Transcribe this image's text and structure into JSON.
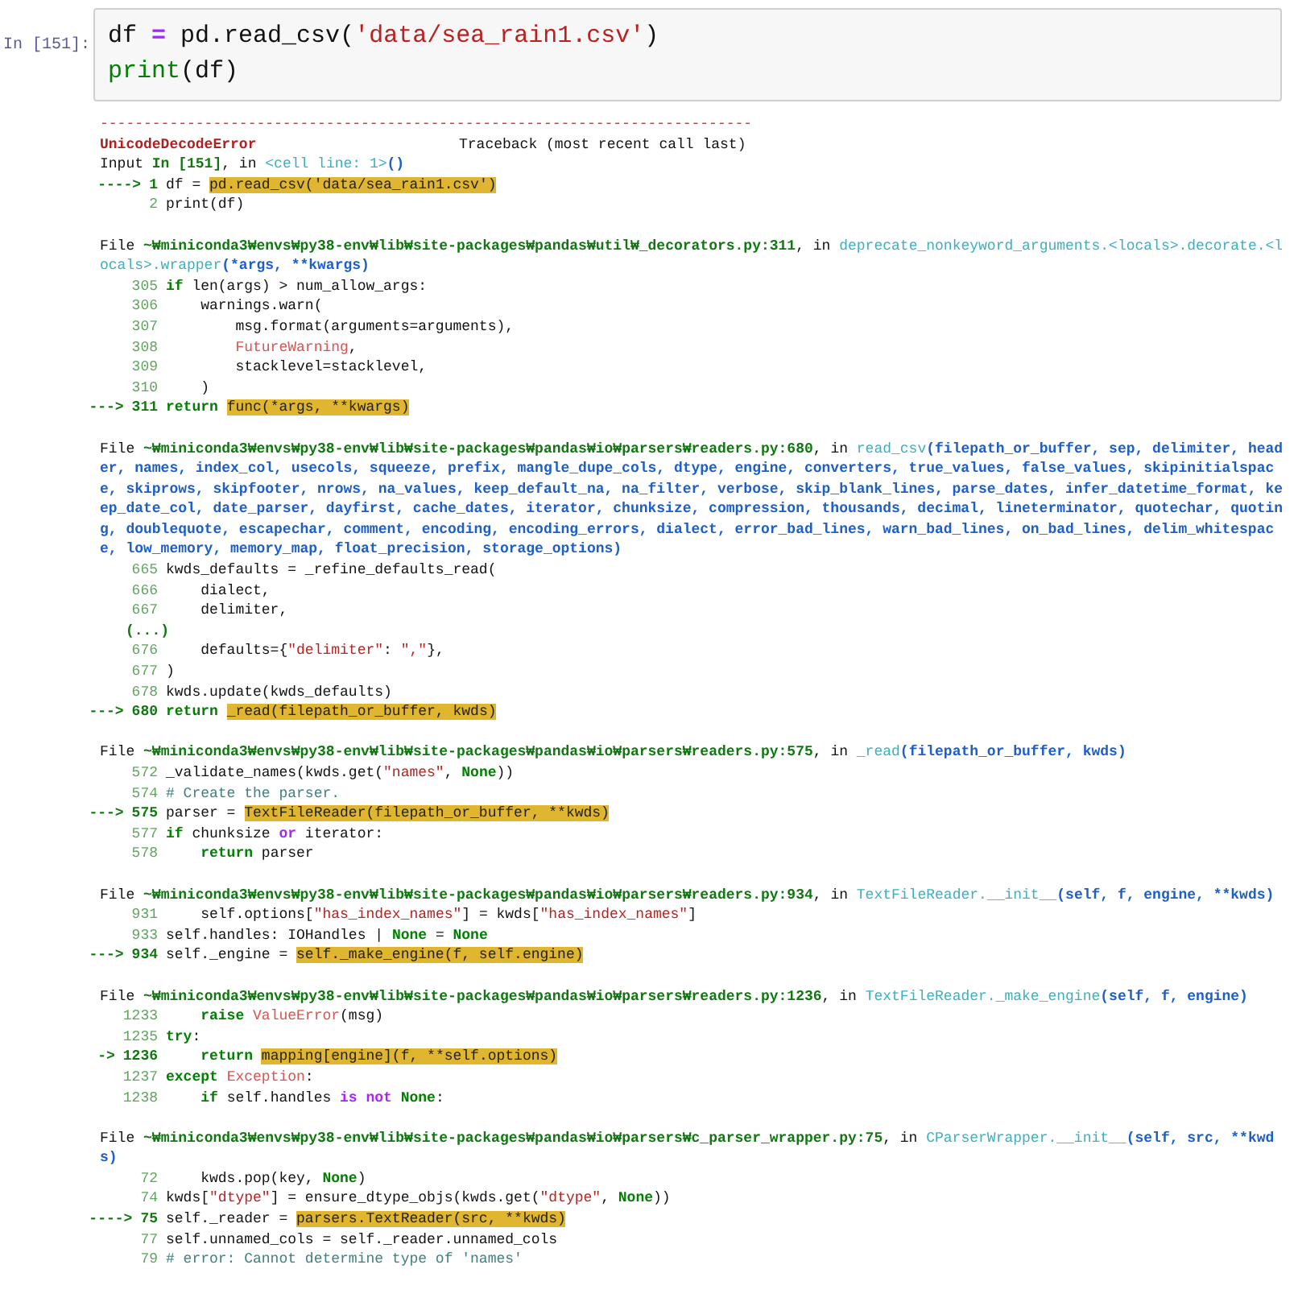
{
  "input_cell": {
    "prompt": "In [151]:",
    "lines": [
      {
        "segments": [
          {
            "text": "df ",
            "kind": "p"
          },
          {
            "text": "=",
            "kind": "op"
          },
          {
            "text": " pd.read_csv(",
            "kind": "p"
          },
          {
            "text": "'data/sea_rain1.csv'",
            "kind": "str"
          },
          {
            "text": ")",
            "kind": "p"
          }
        ]
      },
      {
        "segments": [
          {
            "text": "print",
            "kind": "bi"
          },
          {
            "text": "(df)",
            "kind": "p"
          }
        ]
      }
    ]
  },
  "traceback": {
    "lines": [
      {
        "kind": "rule",
        "text": "---------------------------------------------------------------------------"
      },
      {
        "kind": "header",
        "error": "UnicodeDecodeError",
        "label": "Traceback (most recent call last)"
      },
      {
        "kind": "text",
        "segments": [
          {
            "text": "Input ",
            "kind": "p"
          },
          {
            "text": "In [151]",
            "kind": "path"
          },
          {
            "text": ", in ",
            "kind": "p"
          },
          {
            "text": "<cell line: 1>",
            "kind": "fn"
          },
          {
            "text": "()",
            "kind": "arg"
          }
        ]
      },
      {
        "kind": "src",
        "arrow": "---->",
        "num": "1",
        "segments": [
          {
            "text": "df = ",
            "kind": "p"
          },
          {
            "text": "pd.read_csv('data/sea_rain1.csv')",
            "kind": "hl"
          }
        ]
      },
      {
        "kind": "src",
        "num": "2",
        "segments": [
          {
            "text": "print(df)",
            "kind": "p"
          }
        ]
      },
      {
        "kind": "blank"
      },
      {
        "kind": "text",
        "segments": [
          {
            "text": "File ",
            "kind": "p"
          },
          {
            "text": "~₩miniconda3₩envs₩py38-env₩lib₩site-packages₩pandas₩util₩_decorators.py:311",
            "kind": "path"
          },
          {
            "text": ", in ",
            "kind": "p"
          },
          {
            "text": "deprecate_nonkeyword_arguments.<locals>.decorate.<locals>.wrapper",
            "kind": "fn"
          },
          {
            "text": "(*args, **kwargs)",
            "kind": "arg"
          }
        ]
      },
      {
        "kind": "src",
        "num": "305",
        "segments": [
          {
            "text": "if ",
            "kind": "kw"
          },
          {
            "text": "len(args) > num_allow_args:",
            "kind": "p"
          }
        ]
      },
      {
        "kind": "src",
        "num": "306",
        "segments": [
          {
            "text": "    warnings.warn(",
            "kind": "p"
          }
        ]
      },
      {
        "kind": "src",
        "num": "307",
        "segments": [
          {
            "text": "        msg.format(arguments=arguments),",
            "kind": "p"
          }
        ]
      },
      {
        "kind": "src",
        "num": "308",
        "segments": [
          {
            "text": "        FutureWarning",
            "kind": "exc"
          },
          {
            "text": ",",
            "kind": "p"
          }
        ]
      },
      {
        "kind": "src",
        "num": "309",
        "segments": [
          {
            "text": "        stacklevel=stacklevel,",
            "kind": "p"
          }
        ]
      },
      {
        "kind": "src",
        "num": "310",
        "segments": [
          {
            "text": "    )",
            "kind": "p"
          }
        ]
      },
      {
        "kind": "src",
        "arrow": "--->",
        "num": "311",
        "segments": [
          {
            "text": "return ",
            "kind": "kw"
          },
          {
            "text": "func(*args, **kwargs)",
            "kind": "hl"
          }
        ]
      },
      {
        "kind": "blank"
      },
      {
        "kind": "text",
        "segments": [
          {
            "text": "File ",
            "kind": "p"
          },
          {
            "text": "~₩miniconda3₩envs₩py38-env₩lib₩site-packages₩pandas₩io₩parsers₩readers.py:680",
            "kind": "path"
          },
          {
            "text": ", in ",
            "kind": "p"
          },
          {
            "text": "read_csv",
            "kind": "fn"
          },
          {
            "text": "(filepath_or_buffer, sep, delimiter, header, names, index_col, usecols, squeeze, prefix, mangle_dupe_cols, dtype, engine, converters, true_values, false_values, skipinitialspace, skiprows, skipfooter, nrows, na_values, keep_default_na, na_filter, verbose, skip_blank_lines, parse_dates, infer_datetime_format, keep_date_col, date_parser, dayfirst, cache_dates, iterator, chunksize, compression, thousands, decimal, lineterminator, quotechar, quoting, doublequote, escapechar, comment, encoding, encoding_errors, dialect, error_bad_lines, warn_bad_lines, on_bad_lines, delim_whitespace, low_memory, memory_map, float_precision, storage_options)",
            "kind": "arg"
          }
        ]
      },
      {
        "kind": "src",
        "num": "665",
        "segments": [
          {
            "text": "kwds_defaults = _refine_defaults_read(",
            "kind": "p"
          }
        ]
      },
      {
        "kind": "src",
        "num": "666",
        "segments": [
          {
            "text": "    dialect,",
            "kind": "p"
          }
        ]
      },
      {
        "kind": "src",
        "num": "667",
        "segments": [
          {
            "text": "    delimiter,",
            "kind": "p"
          }
        ]
      },
      {
        "kind": "ellipsis",
        "text": "(...)"
      },
      {
        "kind": "src",
        "num": "676",
        "segments": [
          {
            "text": "    defaults={",
            "kind": "p"
          },
          {
            "text": "\"delimiter\"",
            "kind": "str"
          },
          {
            "text": ": ",
            "kind": "p"
          },
          {
            "text": "\",\"",
            "kind": "str"
          },
          {
            "text": "},",
            "kind": "p"
          }
        ]
      },
      {
        "kind": "src",
        "num": "677",
        "segments": [
          {
            "text": ")",
            "kind": "p"
          }
        ]
      },
      {
        "kind": "src",
        "num": "678",
        "segments": [
          {
            "text": "kwds.update(kwds_defaults)",
            "kind": "p"
          }
        ]
      },
      {
        "kind": "src",
        "arrow": "--->",
        "num": "680",
        "segments": [
          {
            "text": "return ",
            "kind": "kw"
          },
          {
            "text": "_read(filepath_or_buffer, kwds)",
            "kind": "hl"
          }
        ]
      },
      {
        "kind": "blank"
      },
      {
        "kind": "text",
        "segments": [
          {
            "text": "File ",
            "kind": "p"
          },
          {
            "text": "~₩miniconda3₩envs₩py38-env₩lib₩site-packages₩pandas₩io₩parsers₩readers.py:575",
            "kind": "path"
          },
          {
            "text": ", in ",
            "kind": "p"
          },
          {
            "text": "_read",
            "kind": "fn"
          },
          {
            "text": "(filepath_or_buffer, kwds)",
            "kind": "arg"
          }
        ]
      },
      {
        "kind": "src",
        "num": "572",
        "segments": [
          {
            "text": "_validate_names(kwds.get(",
            "kind": "p"
          },
          {
            "text": "\"names\"",
            "kind": "str"
          },
          {
            "text": ", ",
            "kind": "p"
          },
          {
            "text": "None",
            "kind": "nn"
          },
          {
            "text": "))",
            "kind": "p"
          }
        ]
      },
      {
        "kind": "src",
        "num": "574",
        "segments": [
          {
            "text": "# Create the parser.",
            "kind": "cm"
          }
        ]
      },
      {
        "kind": "src",
        "arrow": "--->",
        "num": "575",
        "segments": [
          {
            "text": "parser = ",
            "kind": "p"
          },
          {
            "text": "TextFileReader(filepath_or_buffer, **kwds)",
            "kind": "hl"
          }
        ]
      },
      {
        "kind": "src",
        "num": "577",
        "segments": [
          {
            "text": "if ",
            "kind": "kw"
          },
          {
            "text": "chunksize ",
            "kind": "p"
          },
          {
            "text": "or",
            "kind": "op"
          },
          {
            "text": " iterator:",
            "kind": "p"
          }
        ]
      },
      {
        "kind": "src",
        "num": "578",
        "segments": [
          {
            "text": "    return ",
            "kind": "kw"
          },
          {
            "text": "parser",
            "kind": "p"
          }
        ]
      },
      {
        "kind": "blank"
      },
      {
        "kind": "text",
        "segments": [
          {
            "text": "File ",
            "kind": "p"
          },
          {
            "text": "~₩miniconda3₩envs₩py38-env₩lib₩site-packages₩pandas₩io₩parsers₩readers.py:934",
            "kind": "path"
          },
          {
            "text": ", in ",
            "kind": "p"
          },
          {
            "text": "TextFileReader.__init__",
            "kind": "fn"
          },
          {
            "text": "(self, f, engine, **kwds)",
            "kind": "arg"
          }
        ]
      },
      {
        "kind": "src",
        "num": "931",
        "segments": [
          {
            "text": "    self.options[",
            "kind": "p"
          },
          {
            "text": "\"has_index_names\"",
            "kind": "str"
          },
          {
            "text": "] = kwds[",
            "kind": "p"
          },
          {
            "text": "\"has_index_names\"",
            "kind": "str"
          },
          {
            "text": "]",
            "kind": "p"
          }
        ]
      },
      {
        "kind": "src",
        "num": "933",
        "segments": [
          {
            "text": "self.handles: IOHandles | ",
            "kind": "p"
          },
          {
            "text": "None",
            "kind": "nn"
          },
          {
            "text": " = ",
            "kind": "p"
          },
          {
            "text": "None",
            "kind": "nn"
          }
        ]
      },
      {
        "kind": "src",
        "arrow": "--->",
        "num": "934",
        "segments": [
          {
            "text": "self._engine = ",
            "kind": "p"
          },
          {
            "text": "self._make_engine(f, self.engine)",
            "kind": "hl"
          }
        ]
      },
      {
        "kind": "blank"
      },
      {
        "kind": "text",
        "segments": [
          {
            "text": "File ",
            "kind": "p"
          },
          {
            "text": "~₩miniconda3₩envs₩py38-env₩lib₩site-packages₩pandas₩io₩parsers₩readers.py:1236",
            "kind": "path"
          },
          {
            "text": ", in ",
            "kind": "p"
          },
          {
            "text": "TextFileReader._make_engine",
            "kind": "fn"
          },
          {
            "text": "(self, f, engine)",
            "kind": "arg"
          }
        ]
      },
      {
        "kind": "src",
        "num": "1233",
        "segments": [
          {
            "text": "    raise ",
            "kind": "kw"
          },
          {
            "text": "ValueError",
            "kind": "exc"
          },
          {
            "text": "(msg)",
            "kind": "p"
          }
        ]
      },
      {
        "kind": "src",
        "num": "1235",
        "segments": [
          {
            "text": "try",
            "kind": "kw"
          },
          {
            "text": ":",
            "kind": "p"
          }
        ]
      },
      {
        "kind": "src",
        "arrow": "->",
        "num": "1236",
        "segments": [
          {
            "text": "    return ",
            "kind": "kw"
          },
          {
            "text": "mapping[engine](f, **self.options)",
            "kind": "hl"
          }
        ]
      },
      {
        "kind": "src",
        "num": "1237",
        "segments": [
          {
            "text": "except ",
            "kind": "kw"
          },
          {
            "text": "Exception",
            "kind": "exc"
          },
          {
            "text": ":",
            "kind": "p"
          }
        ]
      },
      {
        "kind": "src",
        "num": "1238",
        "segments": [
          {
            "text": "    if ",
            "kind": "kw"
          },
          {
            "text": "self.handles ",
            "kind": "p"
          },
          {
            "text": "is not",
            "kind": "op"
          },
          {
            "text": " None",
            "kind": "nn"
          },
          {
            "text": ":",
            "kind": "p"
          }
        ]
      },
      {
        "kind": "blank"
      },
      {
        "kind": "text",
        "segments": [
          {
            "text": "File ",
            "kind": "p"
          },
          {
            "text": "~₩miniconda3₩envs₩py38-env₩lib₩site-packages₩pandas₩io₩parsers₩c_parser_wrapper.py:75",
            "kind": "path"
          },
          {
            "text": ", in ",
            "kind": "p"
          },
          {
            "text": "CParserWrapper.__init__",
            "kind": "fn"
          },
          {
            "text": "(self, src, **kwds)",
            "kind": "arg"
          }
        ]
      },
      {
        "kind": "src",
        "num": "72",
        "segments": [
          {
            "text": "    kwds.pop(key, ",
            "kind": "p"
          },
          {
            "text": "None",
            "kind": "nn"
          },
          {
            "text": ")",
            "kind": "p"
          }
        ]
      },
      {
        "kind": "src",
        "num": "74",
        "segments": [
          {
            "text": "kwds[",
            "kind": "p"
          },
          {
            "text": "\"dtype\"",
            "kind": "str"
          },
          {
            "text": "] = ensure_dtype_objs(kwds.get(",
            "kind": "p"
          },
          {
            "text": "\"dtype\"",
            "kind": "str"
          },
          {
            "text": ", ",
            "kind": "p"
          },
          {
            "text": "None",
            "kind": "nn"
          },
          {
            "text": "))",
            "kind": "p"
          }
        ]
      },
      {
        "kind": "src",
        "arrow": "---->",
        "num": "75",
        "segments": [
          {
            "text": "self._reader = ",
            "kind": "p"
          },
          {
            "text": "parsers.TextReader(src, **kwds)",
            "kind": "hl"
          }
        ]
      },
      {
        "kind": "src",
        "num": "77",
        "segments": [
          {
            "text": "self.unnamed_cols = self._reader.unnamed_cols",
            "kind": "p"
          }
        ]
      },
      {
        "kind": "src",
        "num": "79",
        "segments": [
          {
            "text": "# error: Cannot determine type of 'names'",
            "kind": "cm"
          }
        ]
      }
    ]
  }
}
